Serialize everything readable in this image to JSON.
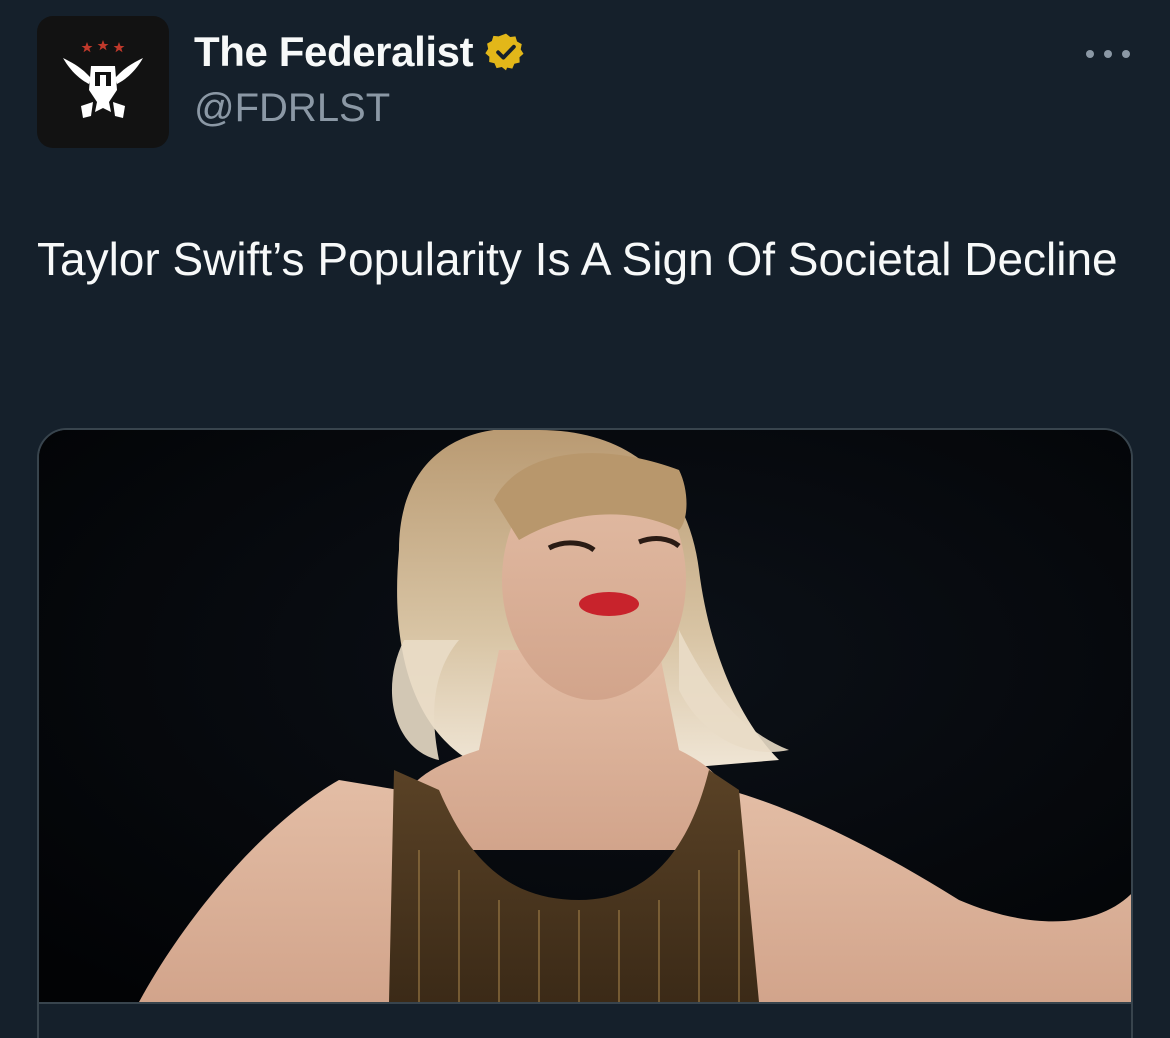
{
  "author": {
    "name": "The Federalist",
    "handle": "@FDRLST",
    "avatar_icon": "eagle-logo-icon",
    "verified_icon": "verified-badge-icon",
    "verified_color": "#e2b719"
  },
  "menu": {
    "icon": "more-options-icon"
  },
  "tweet": {
    "text": "Taylor Swift’s Popularity Is A Sign Of Societal Decline"
  },
  "card": {
    "image_description_icon": "article-photo",
    "domain": ""
  },
  "colors": {
    "background": "#15202b",
    "text_primary": "#f7f9f9",
    "text_secondary": "#8b98a5",
    "border": "#38444d"
  }
}
